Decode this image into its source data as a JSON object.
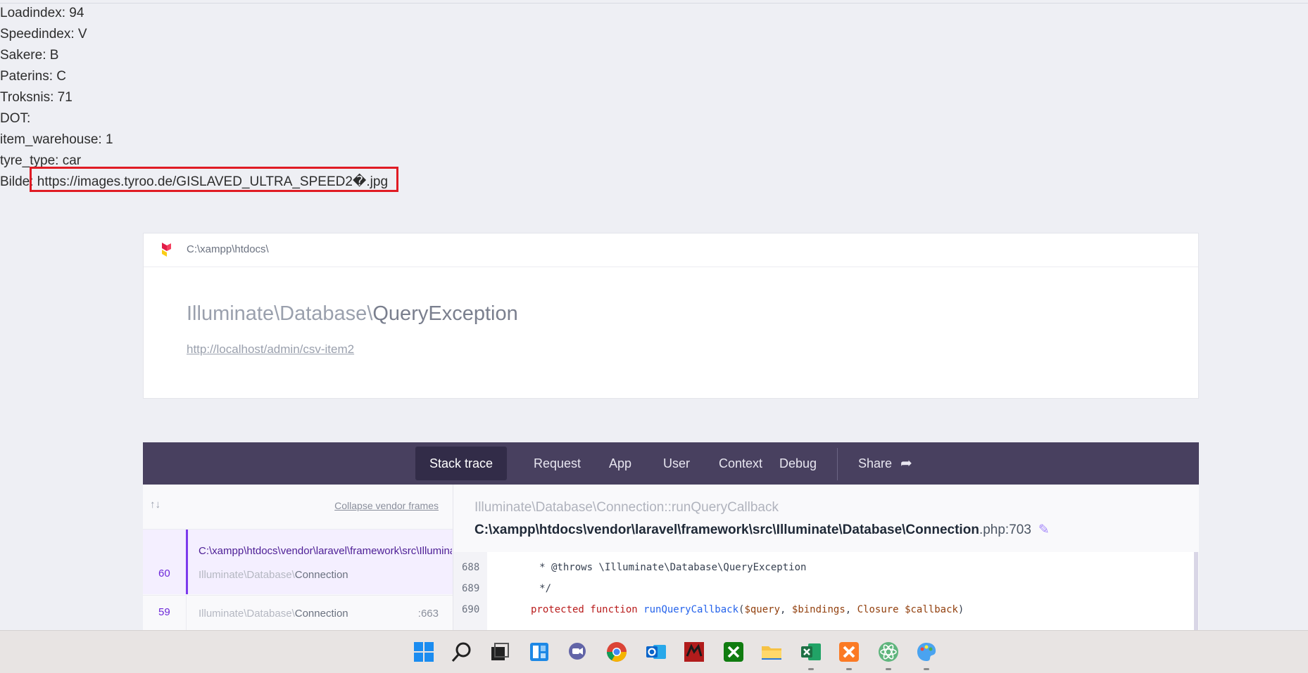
{
  "dump_lines": [
    "Loadindex: 94",
    "Speedindex: V",
    "Sakere: B",
    "Paterins: C",
    "Troksnis: 71",
    "DOT:",
    "item_warehouse: 1",
    "tyre_type: car",
    "Bilde: https://images.tyroo.de/GISLAVED_ULTRA_SPEED2�.jpg"
  ],
  "error_card": {
    "path": "C:\\xampp\\htdocs\\",
    "namespace": "Illuminate\\Database\\",
    "exception_class": "QueryException",
    "url": "http://localhost/admin/csv-item2"
  },
  "tabs": [
    "Stack trace",
    "Request",
    "App",
    "User",
    "Context",
    "Debug",
    "Share"
  ],
  "frames_panel": {
    "collapse_label": "Collapse vendor frames",
    "frames": [
      {
        "number": "60",
        "file": "C:\\xampp\\htdocs\\vendor\\laravel\\framework\\src\\Illuminate\\Database\\Connection.php",
        "namespace": "Illuminate\\Database\\",
        "class": "Connection",
        "line": ""
      },
      {
        "number": "59",
        "file": "",
        "namespace": "Illuminate\\Database\\",
        "class": "Connection",
        "line": ":663"
      }
    ]
  },
  "detail": {
    "namespace": "Illuminate\\Database\\",
    "class": "Connection",
    "method": "::runQueryCallback",
    "file_path": "C:\\xampp\\htdocs\\vendor\\laravel\\framework\\src\\Illuminate\\Database\\Connection",
    "file_ext": ".php:703",
    "code_lines": [
      {
        "n": "688",
        "code": "     * @throws \\Illuminate\\Database\\QueryException"
      },
      {
        "n": "689",
        "code": "     */"
      },
      {
        "n": "690",
        "kw": "protected function",
        "fn": "runQueryCallback",
        "rest_a": "(",
        "v1": "$query",
        "sep1": ", ",
        "v2": "$bindings",
        "sep2": ", ",
        "kw2": "Closure",
        "sp": " ",
        "v3": "$callback",
        "rest_b": ")"
      }
    ]
  },
  "taskbar": {
    "icons": [
      "windows-start-icon",
      "search-icon",
      "task-view-icon",
      "widgets-icon",
      "chat-icon",
      "chrome-icon",
      "outlook-icon",
      "filezilla-icon",
      "xbox-icon",
      "file-explorer-icon",
      "excel-icon",
      "xampp-icon",
      "atom-icon",
      "paint-icon"
    ],
    "colors": {
      "windows": "#1b8cf0",
      "chrome": "#db4437",
      "outlook": "#0a64c9",
      "xbox": "#107c10",
      "explorer": "#f6c244",
      "excel": "#1d7044",
      "xampp": "#fb7a24",
      "atom": "#5fb57d"
    }
  },
  "colors": {
    "highlight_box": "#e01b24",
    "tabs_bg": "#48405f",
    "accent": "#7c3aed"
  }
}
